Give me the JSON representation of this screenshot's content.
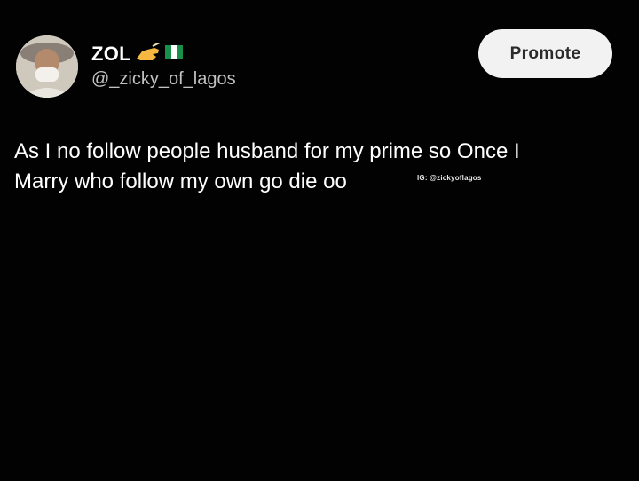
{
  "post": {
    "display_name": "ZOL",
    "display_name_emojis": [
      "writing-hand-emoji",
      "nigeria-flag-emoji"
    ],
    "handle": "@_zicky_of_lagos",
    "text_lines": [
      "As I no follow people husband for my prime so Once I",
      "Marry who follow my own go die oo"
    ],
    "watermark": "IG: @zickyoflagos"
  },
  "actions": {
    "promote_label": "Promote"
  },
  "colors": {
    "background": "#020202",
    "text": "#ffffff",
    "handle": "#c2c2c2",
    "button_bg": "#f2f2f2",
    "button_text": "#2b2b2b",
    "hand_emoji": "#f5b942",
    "flag_green": "#1a8f4a"
  }
}
